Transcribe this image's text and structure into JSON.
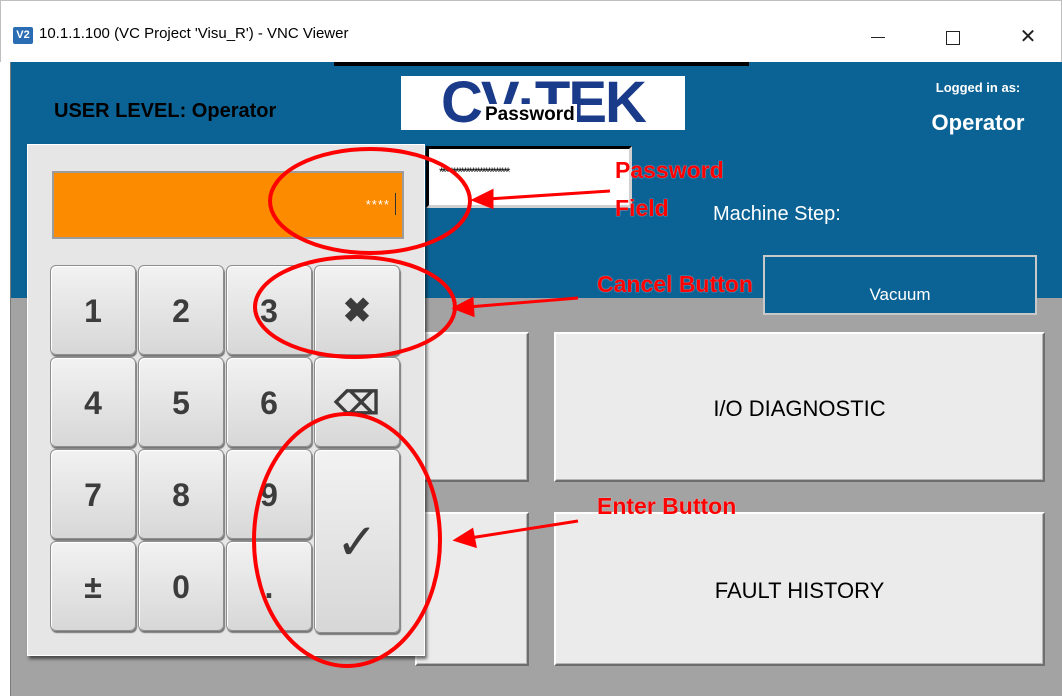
{
  "window": {
    "icon_text": "V2",
    "title": "10.1.1.100 (VC Project 'Visu_R') - VNC Viewer",
    "minimize": "—",
    "maximize": "☐",
    "close": "✕"
  },
  "header": {
    "user_level": "USER LEVEL:  Operator",
    "logo_text": "CV·TEK",
    "logged_in_label": "Logged in as:",
    "logged_in_user": "Operator",
    "machine_step_label": "Machine Step:",
    "vacuum_label": "Vacuum"
  },
  "password_dialog": {
    "title": "Password",
    "field_value": "**************************",
    "keypad_display": "****"
  },
  "keypad": {
    "keys": [
      "1",
      "2",
      "3",
      "✖",
      "4",
      "5",
      "6",
      "⌫",
      "7",
      "8",
      "9",
      "✓",
      "±",
      "0",
      "."
    ]
  },
  "menu": {
    "io_diagnostic": "I/O DIAGNOSTIC",
    "fault_history": "FAULT HISTORY"
  },
  "annotations": {
    "password_field": [
      "Password",
      "Field"
    ],
    "cancel_button": "Cancel Button",
    "enter_button": "Enter Button",
    "color": "#ff0000"
  },
  "colors": {
    "header_blue": "#0b6395",
    "display_orange": "#fd8b00",
    "hmi_gray": "#a3a3a3"
  }
}
